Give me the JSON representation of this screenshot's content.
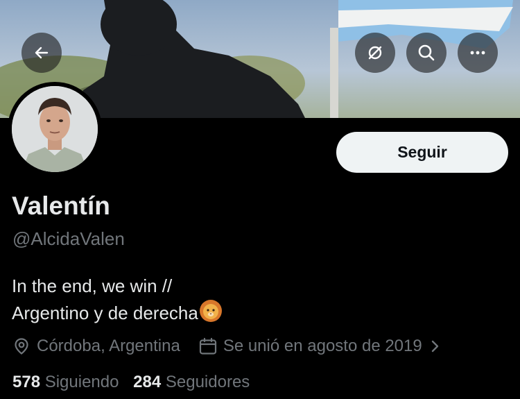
{
  "header": {
    "back_icon": "arrow-left-icon",
    "grok_icon": "grok-icon",
    "search_icon": "search-icon",
    "more_icon": "more-horizontal-icon"
  },
  "profile": {
    "name": "Valentín",
    "handle": "@AlcidaValen",
    "follow_label": "Seguir",
    "bio_line1": "In the end, we win //",
    "bio_line2": "Argentino y de derecha",
    "bio_emoji": "lion-face-emoji",
    "location": "Córdoba, Argentina",
    "joined": "Se unió en agosto de 2019",
    "following_count": "578",
    "following_label": "Siguiendo",
    "followers_count": "284",
    "followers_label": "Seguidores"
  },
  "colors": {
    "background": "#000000",
    "primary_text": "#e7e9ea",
    "secondary_text": "#71767b",
    "follow_button_bg": "#eff3f4",
    "follow_button_text": "#0f1419"
  }
}
